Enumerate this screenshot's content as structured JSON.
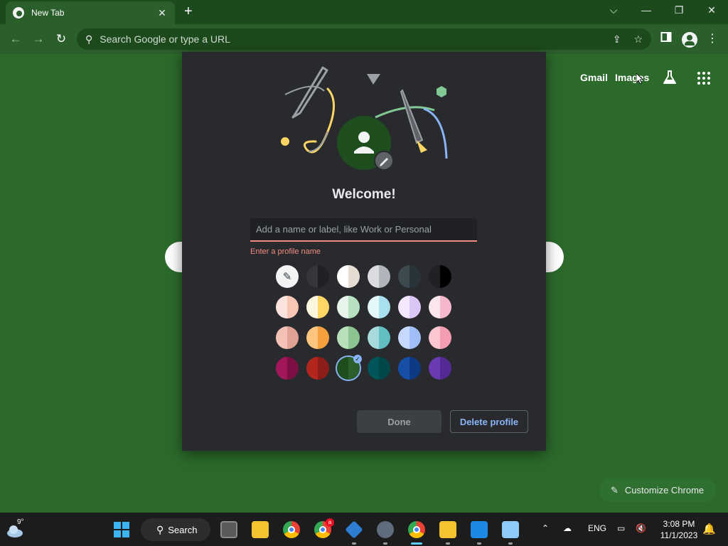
{
  "browser": {
    "tab_title": "New Tab",
    "tab_close": "✕",
    "new_tab": "+",
    "omnibox_placeholder": "Search Google or type a URL",
    "window_controls": {
      "tab_search": "⌵",
      "minimize": "—",
      "restore": "❐",
      "close": "✕"
    },
    "nav": {
      "back": "←",
      "forward": "→",
      "reload": "↻"
    },
    "menu": "⋮"
  },
  "ntp": {
    "gmail_label": "Gmail",
    "images_label": "Images",
    "customize_label": "Customize Chrome",
    "customize_icon": "✎"
  },
  "dialog": {
    "welcome": "Welcome!",
    "name_placeholder": "Add a name or label, like Work or Personal",
    "name_value": "",
    "error": "Enter a profile name",
    "done_label": "Done",
    "delete_label": "Delete profile",
    "picker_icon": "✎",
    "selected_index": 14,
    "colors": [
      {
        "name": "custom-color-picker",
        "left": "#f1f3f4",
        "right": "#f1f3f4"
      },
      {
        "name": "grey-dark",
        "left": "#35363a",
        "right": "#202124"
      },
      {
        "name": "white-beige",
        "left": "#ffffff",
        "right": "#e6ddd2"
      },
      {
        "name": "light-grey",
        "left": "#dadce0",
        "right": "#b0b4bb"
      },
      {
        "name": "slate",
        "left": "#3c4a50",
        "right": "#28343a"
      },
      {
        "name": "black",
        "left": "#202124",
        "right": "#000000"
      },
      {
        "name": "peach-light",
        "left": "#fde3dd",
        "right": "#f8c6b5"
      },
      {
        "name": "yellow",
        "left": "#fff8e1",
        "right": "#fdd663"
      },
      {
        "name": "green-light",
        "left": "#e6f4ea",
        "right": "#b7e1c1"
      },
      {
        "name": "cyan-light",
        "left": "#e4f7fb",
        "right": "#a8e0ed"
      },
      {
        "name": "lavender-light",
        "left": "#f3e8fd",
        "right": "#dac7f5"
      },
      {
        "name": "pink-light",
        "left": "#fde7ef",
        "right": "#f5b8cb"
      },
      {
        "name": "salmon",
        "left": "#f3c1b5",
        "right": "#e0a294"
      },
      {
        "name": "orange",
        "left": "#fbc57d",
        "right": "#f4a03c"
      },
      {
        "name": "sage",
        "left": "#b7dfb9",
        "right": "#8dc592"
      },
      {
        "name": "teal-light",
        "left": "#a7dbdb",
        "right": "#63bec2"
      },
      {
        "name": "periwinkle",
        "left": "#c6d8fb",
        "right": "#9fbef5"
      },
      {
        "name": "rose",
        "left": "#fcc7d0",
        "right": "#f59db0"
      },
      {
        "name": "magenta",
        "left": "#a2175a",
        "right": "#7c0f43"
      },
      {
        "name": "red",
        "left": "#b3261e",
        "right": "#8c1d18"
      },
      {
        "name": "green-dark",
        "left": "#1e4d1e",
        "right": "#2a5e2a"
      },
      {
        "name": "teal-dark",
        "left": "#00565a",
        "right": "#00474a"
      },
      {
        "name": "blue-dark",
        "left": "#174ea6",
        "right": "#0d3a82"
      },
      {
        "name": "purple",
        "left": "#6a3ab2",
        "right": "#532a93"
      }
    ]
  },
  "taskbar": {
    "weather_temp": "9°",
    "search_label": "Search",
    "language": "ENG",
    "time": "3:08 PM",
    "date": "11/1/2023",
    "chrome_badge": "a"
  },
  "colors": {
    "page_bg": "#2b6a2b",
    "tabstrip_bg": "#1d4a1d",
    "dialog_bg": "#292a2d",
    "error": "#f28b82",
    "accent": "#8ab4f8"
  }
}
